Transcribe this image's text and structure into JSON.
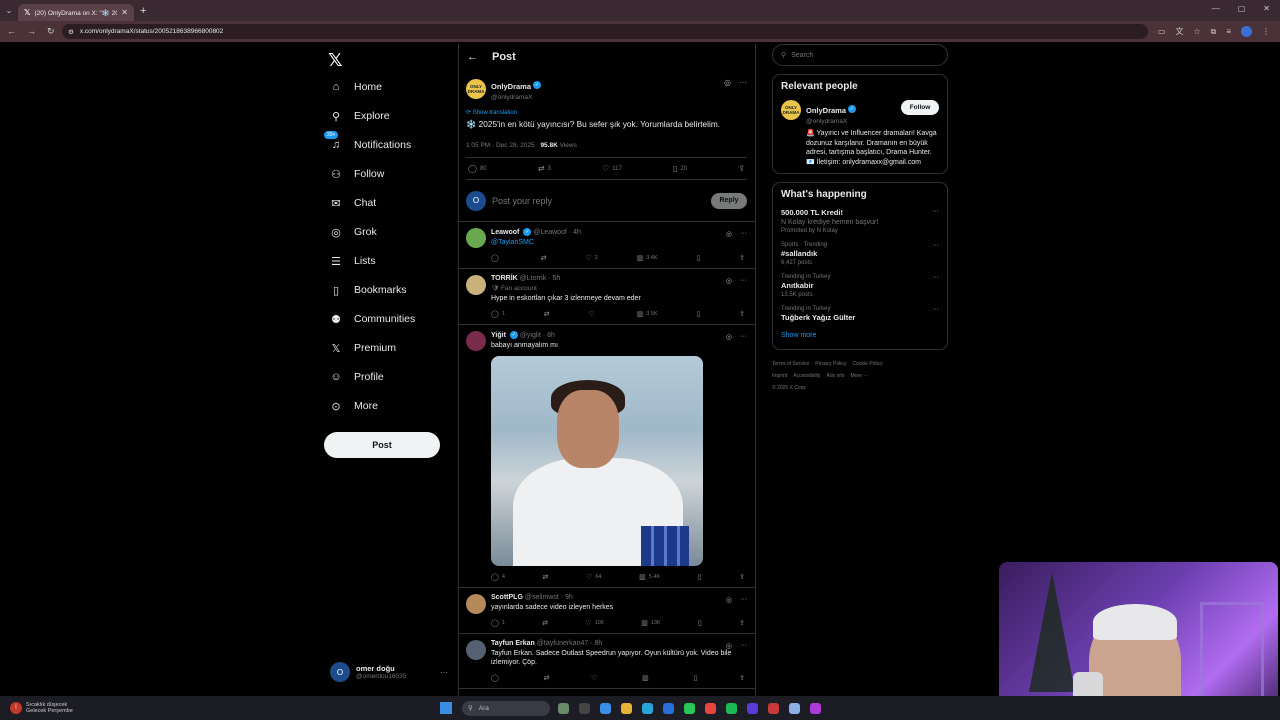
{
  "browser": {
    "tab_title": "(20) OnlyDrama on X: \"❄️ 202...",
    "url": "x.com/onlydramaX/status/2005218638966800802"
  },
  "nav": {
    "items": [
      {
        "label": "Home",
        "icon": "home-icon",
        "glyph": "⌂"
      },
      {
        "label": "Explore",
        "icon": "search-icon",
        "glyph": "⚲"
      },
      {
        "label": "Notifications",
        "icon": "bell-icon",
        "glyph": "♫"
      },
      {
        "label": "Follow",
        "icon": "follow-icon",
        "glyph": "⚇"
      },
      {
        "label": "Chat",
        "icon": "mail-icon",
        "glyph": "✉"
      },
      {
        "label": "Grok",
        "icon": "grok-icon",
        "glyph": "◎"
      },
      {
        "label": "Lists",
        "icon": "list-icon",
        "glyph": "☰"
      },
      {
        "label": "Bookmarks",
        "icon": "bookmark-icon",
        "glyph": "▯"
      },
      {
        "label": "Communities",
        "icon": "communities-icon",
        "glyph": "⚉"
      },
      {
        "label": "Premium",
        "icon": "x-icon",
        "glyph": "𝕏"
      },
      {
        "label": "Profile",
        "icon": "profile-icon",
        "glyph": "☺"
      },
      {
        "label": "More",
        "icon": "more-icon",
        "glyph": "⊙"
      }
    ],
    "notif_badge": "20+",
    "post_label": "Post",
    "account": {
      "name": "omer doğu",
      "handle": "@omerdou16035",
      "initial": "O"
    }
  },
  "header": {
    "title": "Post"
  },
  "main_post": {
    "name": "OnlyDrama",
    "handle": "@onlydramaX",
    "avatar_text": "ONLY DRAMA",
    "translation": "Show translation",
    "text": "❄️ 2025'in en kötü yayıncısı? Bu sefer şık yok. Yorumlarda belirtelim.",
    "time": "1:05 PM · Dec 28, 2025 ·",
    "views": "95.8K",
    "views_label": "Views",
    "replies": "80",
    "reposts": "3",
    "likes": "117",
    "bookmarks": "20"
  },
  "reply_box": {
    "placeholder": "Post your reply",
    "button": "Reply",
    "initial": "O"
  },
  "replies": [
    {
      "name": "Leawoof",
      "handle": "@Leawoof · 4h",
      "text": "@TaylanSMC",
      "link": true,
      "reply_count": "",
      "like_count": "2",
      "views": "3.4K",
      "avatar_color": "#6aa84f"
    },
    {
      "name": "TORRİK",
      "handle": "@Ltorrik · 5h",
      "fan": "🛡 Fan account",
      "text": "Hype in eskortları çıkar 3 izlenmeye devam eder",
      "reply_count": "1",
      "like_count": "",
      "views": "3.5K",
      "avatar_color": "#c9b27a"
    },
    {
      "name": "Yiğit",
      "handle": "@yiglit · 8h",
      "text": "babayı anmayalım mı",
      "reply_count": "4",
      "like_count": "64",
      "views": "5.4K",
      "avatar_color": "#7a2a4a"
    },
    {
      "name": "ScottPLG",
      "handle": "@selimwst · 9h",
      "text": "yayınlarda sadece video izleyen herkes",
      "reply_count": "1",
      "like_count": "106",
      "views": "13K",
      "avatar_color": "#b48a5a"
    },
    {
      "name": "Tayfun Erkan",
      "handle": "@tayfunerkan47 · 8h",
      "text": "Tayfun Erkan. Sadece Outlast Speedrun yapıyor. Oyun kültürü yok. Video bile izlemiyor. Çöp.",
      "reply_count": "",
      "like_count": "",
      "views": "",
      "avatar_color": "#556070"
    }
  ],
  "right": {
    "search_placeholder": "Search",
    "relevant_title": "Relevant people",
    "person": {
      "name": "OnlyDrama",
      "handle": "@onlydramaX",
      "follow": "Follow",
      "bio": "🚨 Yayıncı ve Influencer dramaları! Kavga dozunuz karşılanır. Dramanın en büyük adresi, tartışma başlatıcı, Drama Hunter. 📧 İletişim: onlydramaxx@gmail.com"
    },
    "happening_title": "What's happening",
    "trends": [
      {
        "cat": "",
        "title": "500.000 TL Kredi!",
        "sub": "N Kolay krediye hemen başvur!",
        "extra": "Promoted by N Kolay"
      },
      {
        "cat": "Sports · Trending",
        "title": "#sallandık",
        "sub": "6,427 posts",
        "extra": ""
      },
      {
        "cat": "Trending in Turkey",
        "title": "Anıtkabir",
        "sub": "13.5K posts",
        "extra": ""
      },
      {
        "cat": "Trending in Turkey",
        "title": "Tuğberk Yağız Gülter",
        "sub": "",
        "extra": ""
      }
    ],
    "show_more": "Show more",
    "footer": [
      "Terms of Service",
      "Privacy Policy",
      "Cookie Policy",
      "Imprint",
      "Accessibility",
      "Ads info",
      "More ···",
      "© 2025 X Corp."
    ]
  },
  "taskbar": {
    "weather_line1": "Sıcaklık düşecek",
    "weather_line2": "Gelecek Perşembe",
    "search": "Ara"
  }
}
